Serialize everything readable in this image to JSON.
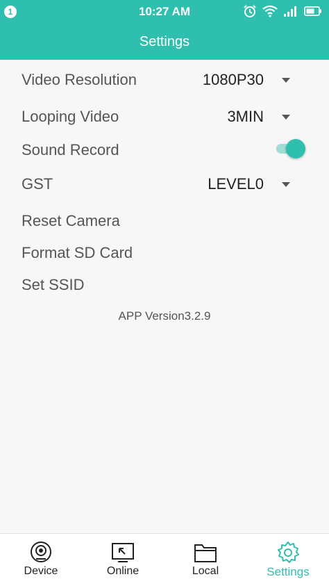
{
  "status_bar": {
    "notification_count": "1",
    "time": "10:27 AM",
    "icons": [
      "alarm-icon",
      "wifi-icon",
      "signal-icon",
      "battery-icon"
    ]
  },
  "header": {
    "title": "Settings"
  },
  "settings": {
    "video_resolution": {
      "label": "Video Resolution",
      "value": "1080P30"
    },
    "looping_video": {
      "label": "Looping Video",
      "value": "3MIN"
    },
    "sound_record": {
      "label": "Sound Record",
      "enabled": true
    },
    "gst": {
      "label": "GST",
      "value": "LEVEL0"
    },
    "reset_camera": {
      "label": "Reset Camera"
    },
    "format_sd_card": {
      "label": "Format SD Card"
    },
    "set_ssid": {
      "label": "Set SSID"
    }
  },
  "app_version": "APP Version3.2.9",
  "tabs": [
    {
      "label": "Device",
      "icon": "webcam-icon"
    },
    {
      "label": "Online",
      "icon": "online-icon"
    },
    {
      "label": "Local",
      "icon": "folder-icon"
    },
    {
      "label": "Settings",
      "icon": "gear-icon",
      "active": true
    }
  ],
  "colors": {
    "accent": "#2fbfae",
    "toggle_track": "#9fdcd3"
  }
}
